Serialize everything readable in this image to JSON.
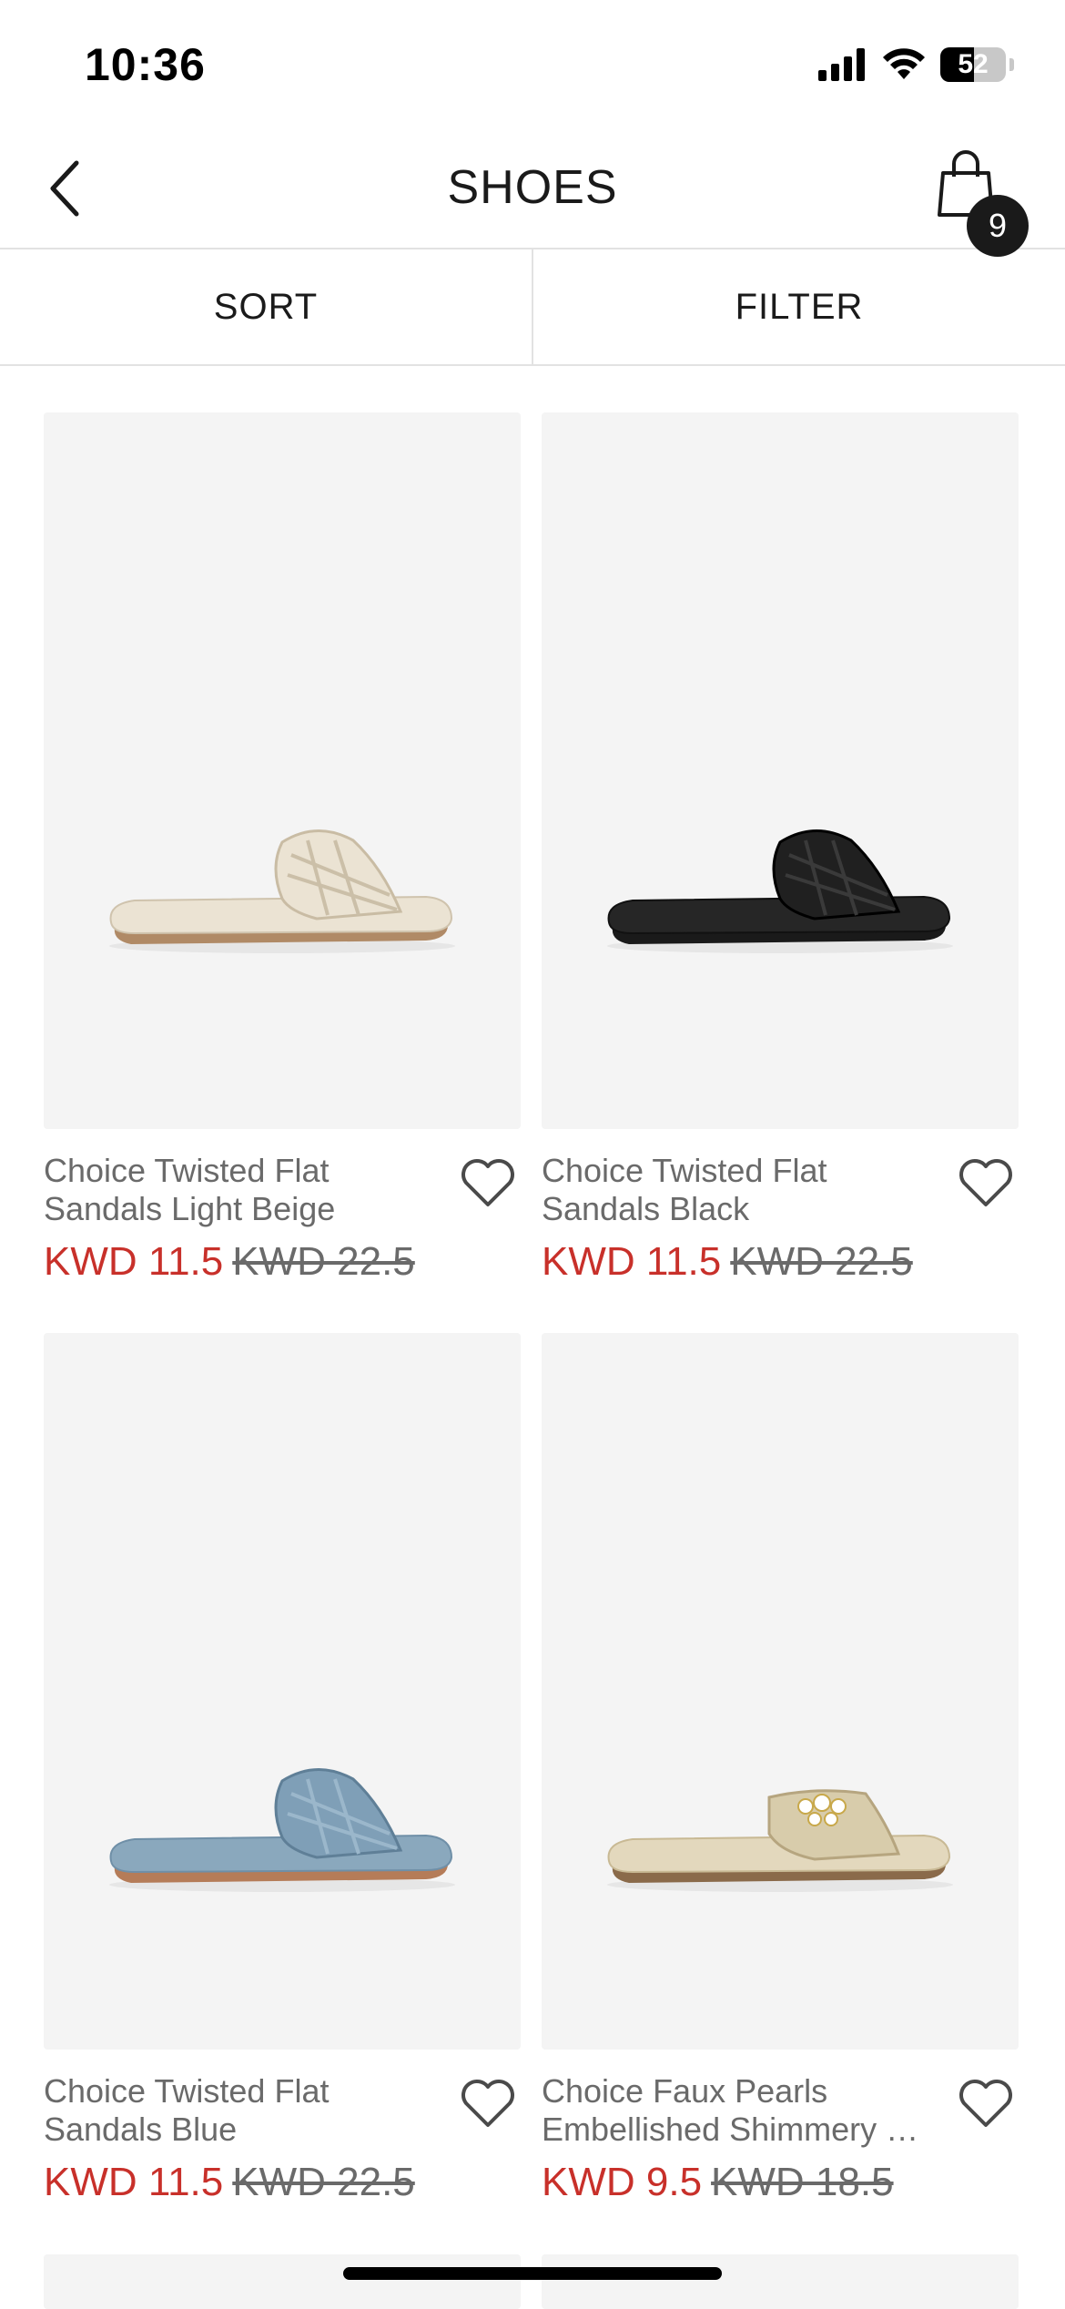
{
  "status": {
    "time": "10:36",
    "battery": "52"
  },
  "header": {
    "title": "SHOES",
    "cart_count": "9"
  },
  "toolbar": {
    "sort_label": "SORT",
    "filter_label": "FILTER"
  },
  "products": [
    {
      "name_line1": "Choice Twisted Flat",
      "name_line2": "Sandals Light Beige",
      "sale_price": "KWD 11.5",
      "original_price": "KWD 22.5",
      "color": "#ebe3d3"
    },
    {
      "name_line1": "Choice Twisted Flat",
      "name_line2": "Sandals Black",
      "sale_price": "KWD 11.5",
      "original_price": "KWD 22.5",
      "color": "#202020"
    },
    {
      "name_line1": "Choice Twisted Flat",
      "name_line2": "Sandals Blue",
      "sale_price": "KWD 11.5",
      "original_price": "KWD 22.5",
      "color": "#7f9fb7"
    },
    {
      "name_line1": "Choice Faux Pearls",
      "name_line2": "Embellished Shimmery S...",
      "sale_price": "KWD 9.5",
      "original_price": "KWD 18.5",
      "color": "#d8ccab"
    }
  ],
  "colors": {
    "sale": "#c8302a",
    "muted_text": "#6a6a6a",
    "image_bg": "#f4f4f4"
  },
  "icons": {
    "back": "chevron-left-icon",
    "cart": "shopping-bag-icon",
    "wishlist": "heart-icon"
  }
}
